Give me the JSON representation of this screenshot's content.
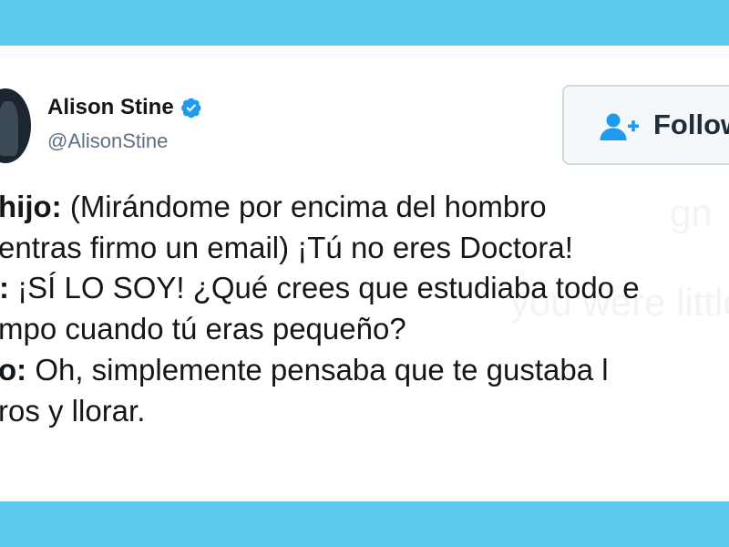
{
  "user": {
    "display_name": "Alison Stine",
    "handle": "@AlisonStine",
    "verified_icon": "verified-badge-icon",
    "avatar_icon": "profile-avatar"
  },
  "follow_button": {
    "label": "Follow",
    "icon": "follow-person-plus-icon"
  },
  "tweet": {
    "lines": [
      {
        "speaker": "hijo:",
        "text": " (Mirándome por encima del hombro"
      },
      {
        "speaker": "",
        "text": "entras firmo un email) ¡Tú no eres Doctora!"
      },
      {
        "speaker": ":",
        "text": " ¡SÍ LO SOY! ¿Qué crees que estudiaba todo e"
      },
      {
        "speaker": "",
        "text": "mpo cuando tú eras pequeño?"
      },
      {
        "speaker": "o:",
        "text": " Oh, simplemente pensaba que te gustaba l"
      },
      {
        "speaker": "",
        "text": "ros y llorar."
      }
    ]
  },
  "colors": {
    "background": "#5bc8ee",
    "card": "#ffffff",
    "verified": "#1d9bf0",
    "follow_text": "#1f2d3a",
    "follow_icon": "#1d9bf0",
    "handle": "#5b7083"
  }
}
